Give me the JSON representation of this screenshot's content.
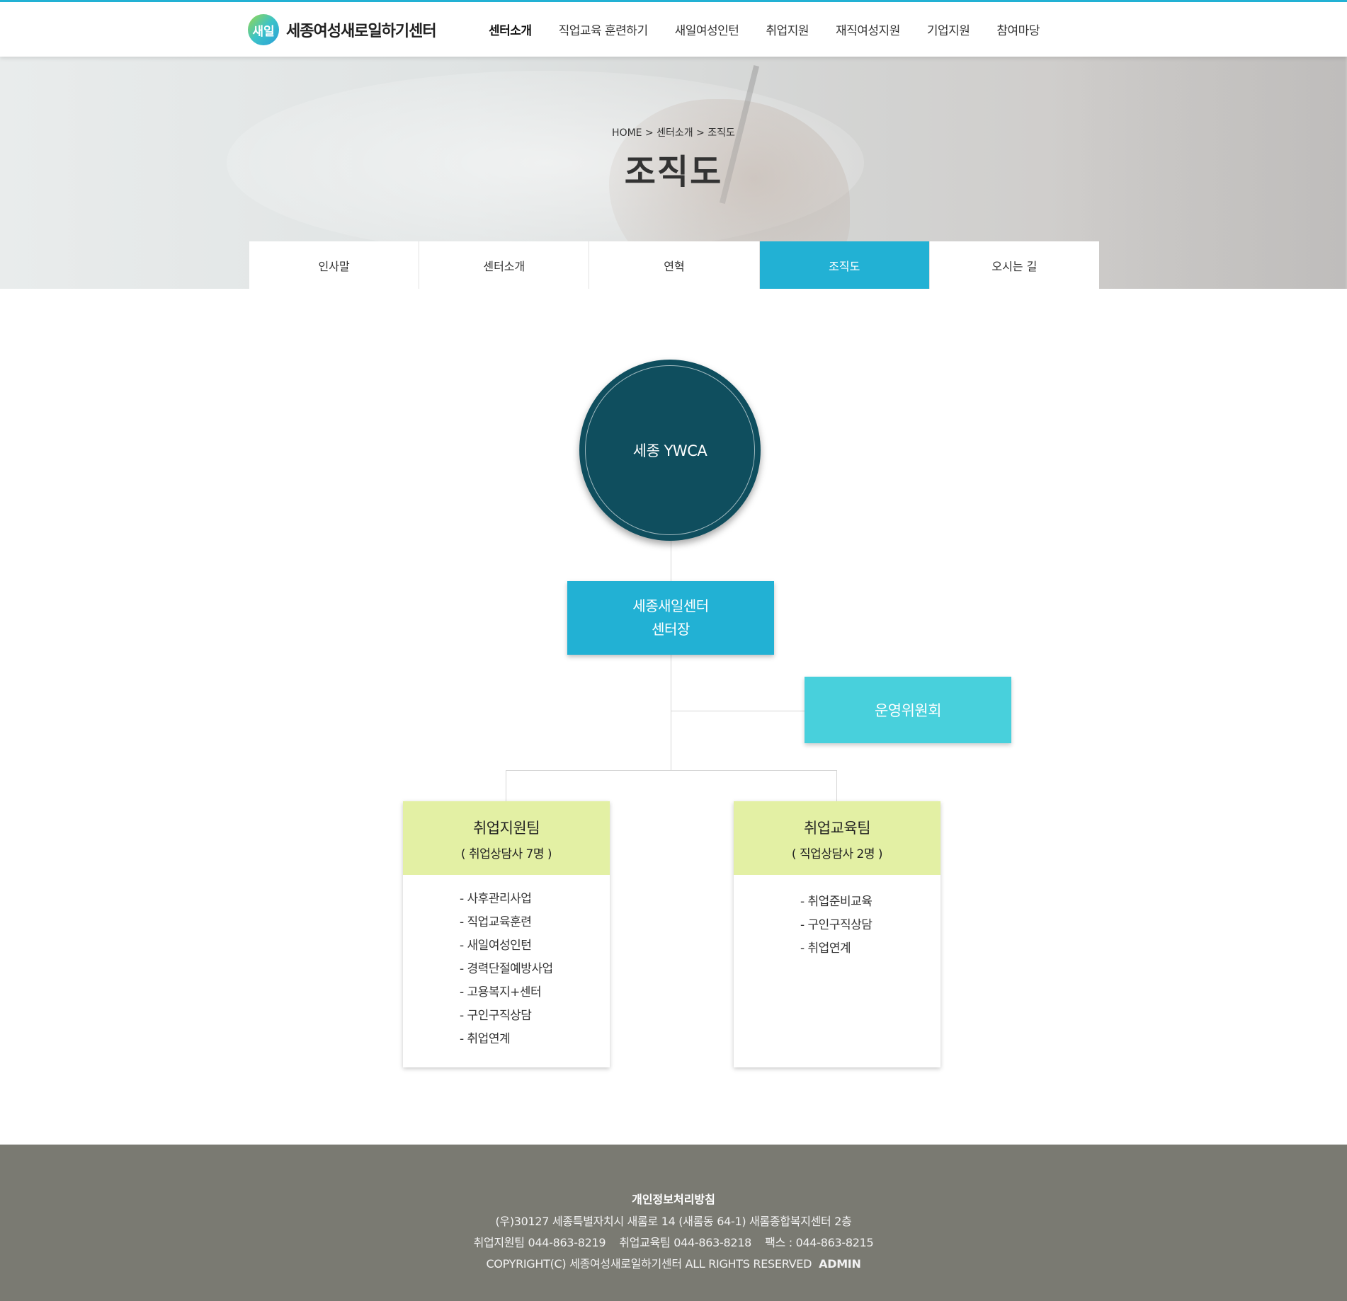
{
  "header": {
    "logo_mark": "새일",
    "logo_text": "세종여성새로일하기센터",
    "nav": [
      "센터소개",
      "직업교육 훈련하기",
      "새일여성인턴",
      "취업지원",
      "재직여성지원",
      "기업지원",
      "참여마당"
    ]
  },
  "hero": {
    "breadcrumb": "HOME > 센터소개 > 조직도",
    "title": "조직도"
  },
  "subtabs": [
    "인사말",
    "센터소개",
    "연혁",
    "조직도",
    "오시는 길"
  ],
  "org": {
    "top": "세종 YWCA",
    "director_line1": "세종새일센터",
    "director_line2": "센터장",
    "committee": "운영위원회",
    "teams": [
      {
        "name": "취업지원팀",
        "sub": "( 취업상담사 7명 )",
        "items": [
          "- 사후관리사업",
          "- 직업교육훈련",
          "- 새일여성인턴",
          "- 경력단절예방사업",
          "- 고용복지+센터",
          "- 구인구직상담",
          "- 취업연계"
        ]
      },
      {
        "name": "취업교육팀",
        "sub": "( 직업상담사 2명 )",
        "items": [
          "- 취업준비교육",
          "- 구인구직상담",
          "- 취업연계"
        ]
      }
    ]
  },
  "footer": {
    "policy": "개인정보처리방침",
    "address": "(우)30127 세종특별자치시 새롬로 14 (새롬동 64-1) 새롬종합복지센터 2층",
    "phones": "취업지원팀 044-863-8219    취업교육팀 044-863-8218    팩스 : 044-863-8215",
    "copyright": "COPYRIGHT(C) 세종여성새로일하기센터 ALL RIGHTS RESERVED",
    "admin": "ADMIN"
  },
  "colors": {
    "accent": "#22b1d4",
    "ywca_circle": "#0f4e5e",
    "committee": "#48d0dc",
    "team_header": "#e3f0a4",
    "footer_bg": "#7a7a72"
  }
}
